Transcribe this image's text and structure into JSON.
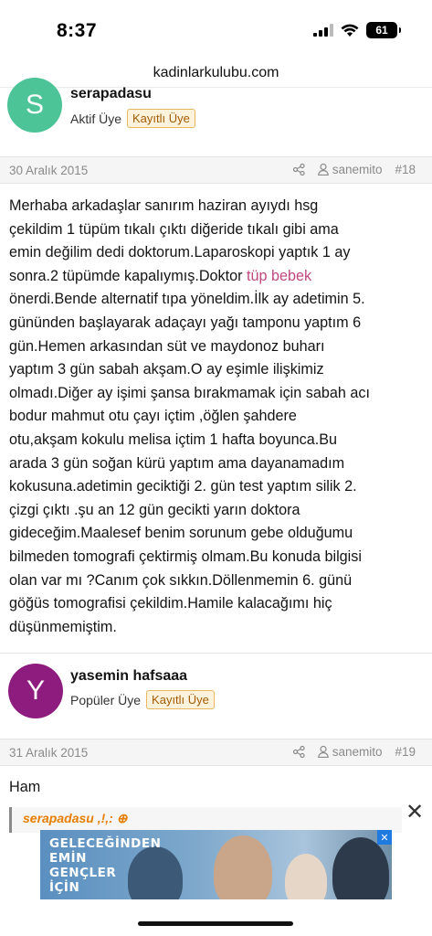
{
  "status_bar": {
    "time": "8:37",
    "battery": "61"
  },
  "url_bar": {
    "domain": "kadinlarkulubu.com"
  },
  "posts": [
    {
      "avatar_letter": "S",
      "avatar_color": "#4cc497",
      "username": "serapadasu",
      "role": "Aktif Üye",
      "badge": "Kayıtlı Üye",
      "date": "30 Aralık 2015",
      "mention_user": "sanemito",
      "post_number": "#18",
      "body_lines": [
        "Merhaba arkadaşlar sanırım haziran ayıydı hsg",
        "çekildim 1 tüpüm tıkalı çıktı diğeride tıkalı gibi ama",
        "emin değilim dedi doktorum.Laparoskopi yaptık 1 ay",
        "sonra.2 tüpümde kapalıymış.Doktor ",
        "önerdi.Bende alternatif tıpa yöneldim.İlk ay adetimin 5.",
        "gününden başlayarak adaçayı yağı tamponu yaptım 6",
        "gün.Hemen arkasından süt ve maydonoz buharı",
        "yaptım 3 gün sabah akşam.O ay eşimle ilişkimiz",
        "olmadı.Diğer ay işimi şansa bırakmamak için sabah acı",
        "bodur mahmut otu çayı içtim ,öğlen şahdere",
        "otu,akşam kokulu melisa içtim 1 hafta boyunca.Bu",
        "arada 3 gün soğan kürü yaptım ama dayanamadım",
        "kokusuna.adetimin geciktiği 2. gün test yaptım silik 2.",
        "çizgi çıktı .şu an 12 gün gecikti yarın doktora",
        "gideceğim.Maalesef benim sorunum gebe olduğumu",
        "bilmeden tomografi çektirmiş olmam.Bu konuda bilgisi",
        "olan var mı ?Canım çok sıkkın.Döllenmemin 6. günü",
        "göğüs tomografisi çekildim.Hamile kalacağımı hiç",
        "düşünmemiştim."
      ],
      "link_text": "tüp bebek"
    },
    {
      "avatar_letter": "Y",
      "avatar_color": "#8e1c7e",
      "username": "yasemin hafsaaa",
      "role": "Popüler Üye",
      "badge": "Kayıtlı Üye",
      "date": "31 Aralık 2015",
      "mention_user": "sanemito",
      "post_number": "#19",
      "body": "Ham",
      "quote_author": "serapadasu ,!,: ⊕"
    }
  ],
  "ad": {
    "lines": [
      "GELECEĞİNDEN",
      "EMİN",
      "GENÇLER",
      "İÇİN"
    ],
    "close_label": "✕"
  },
  "close_button": "✕"
}
